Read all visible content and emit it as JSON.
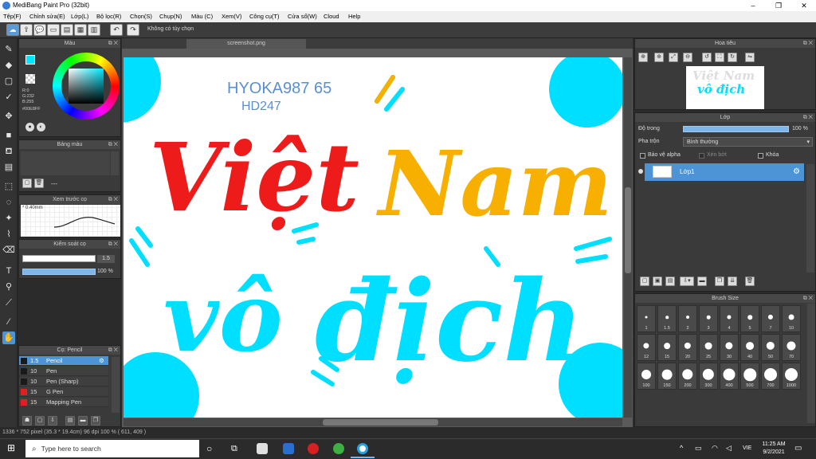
{
  "app": {
    "title": "MediBang Paint Pro (32bit)"
  },
  "menu": [
    "Tệp(F)",
    "Chỉnh sửa(E)",
    "Lớp(L)",
    "Bộ lọc(R)",
    "Chọn(S)",
    "Chụp(N)",
    "Màu (C)",
    "Xem(V)",
    "Công cụ(T)",
    "Cửa sổ(W)",
    "Cloud",
    "Help"
  ],
  "toolbar": {
    "no_option_label": "Không có tùy chọn"
  },
  "color_panel": {
    "title": "Màu",
    "rgb_r": "R:0",
    "rgb_g": "G:232",
    "rgb_b": "B:255",
    "hex": "#00E8FF",
    "fg_color": "#00e8ff",
    "bg_color": "#ffffff"
  },
  "palette_panel": {
    "title": "Bảng màu",
    "entry": "---"
  },
  "brush_preview_panel": {
    "title": "Xem trước cọ",
    "size": "* 0.40mm"
  },
  "brush_control_panel": {
    "title": "Kiểm soát cọ",
    "size_value": "1.5",
    "opacity_value": "100 %",
    "size_fraction": 1.0,
    "opacity_fraction": 1.0
  },
  "brush_list_panel": {
    "title": "Cọ: Pencil",
    "items": [
      {
        "size": "1.5",
        "name": "Pencil",
        "color": "#1a1a1a"
      },
      {
        "size": "10",
        "name": "Pen",
        "color": "#1a1a1a"
      },
      {
        "size": "10",
        "name": "Pen (Sharp)",
        "color": "#1a1a1a"
      },
      {
        "size": "15",
        "name": "G Pen",
        "color": "#e02020"
      },
      {
        "size": "15",
        "name": "Mapping Pen",
        "color": "#e02020"
      }
    ]
  },
  "document": {
    "tab_name": "screenshot.png",
    "top_handwriting": "HYOKA987 65",
    "second_handwriting": "HD247",
    "word_viet": "Việt",
    "word_nam": "Nam",
    "word_vo": "vô",
    "word_dich": "địch"
  },
  "navigator_panel": {
    "title": "Hoa tiêu",
    "thumb_line1": "Việt Nam",
    "thumb_line2": "vô địch"
  },
  "layer_panel": {
    "title": "Lớp",
    "opacity_label": "Độ trong",
    "opacity_value": "100 %",
    "opacity_fraction": 1.0,
    "blend_label": "Pha trộn",
    "blend_value": "Bình thường",
    "protect_alpha": "Bảo vệ alpha",
    "clipping": "Xén bớt",
    "lock": "Khóa",
    "layer_name": "Lớp1"
  },
  "brush_size_panel": {
    "title": "Brush Size",
    "sizes": [
      "1",
      "1.5",
      "2",
      "3",
      "4",
      "5",
      "7",
      "10",
      "12",
      "15",
      "20",
      "25",
      "30",
      "40",
      "50",
      "70",
      "100",
      "150",
      "200",
      "300",
      "400",
      "500",
      "700",
      "1000"
    ]
  },
  "status": {
    "text": "1336 * 752 pixel   (35.3 * 19.4cm)   96 dpi   100 %   ( 611, 409 )"
  },
  "taskbar": {
    "search_placeholder": "Type here to search",
    "time": "11:25 AM",
    "date": "9/2/2021",
    "lang": "VIE"
  }
}
